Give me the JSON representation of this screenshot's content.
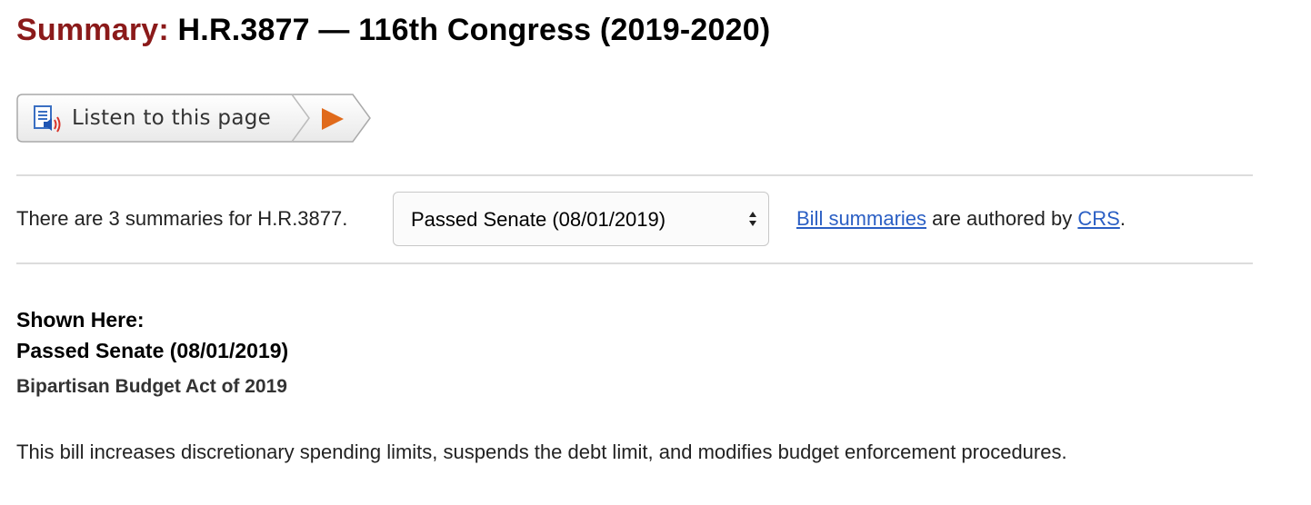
{
  "header": {
    "prefix": "Summary:",
    "bill": "H.R.3877 — 116th Congress (2019-2020)"
  },
  "listen": {
    "label": "Listen to this page",
    "speaker_icon": "document-speaker-icon",
    "play_icon": "play-icon",
    "play_color": "#e06a1b"
  },
  "summaries": {
    "count_text": "There are 3 summaries for H.R.3877.",
    "selected_version": "Passed Senate (08/01/2019)",
    "authored": {
      "link1": "Bill summaries",
      "middle": " are authored by ",
      "link2": "CRS",
      "end": "."
    }
  },
  "shown": {
    "label": "Shown Here:",
    "version": "Passed Senate (08/01/2019)",
    "act_title": "Bipartisan Budget Act of 2019",
    "text": "This bill increases discretionary spending limits, suspends the debt limit, and modifies budget enforcement procedures."
  },
  "colors": {
    "title_prefix": "#8b1a1a",
    "link": "#2b5fc4",
    "divider": "#dcdcdc"
  }
}
